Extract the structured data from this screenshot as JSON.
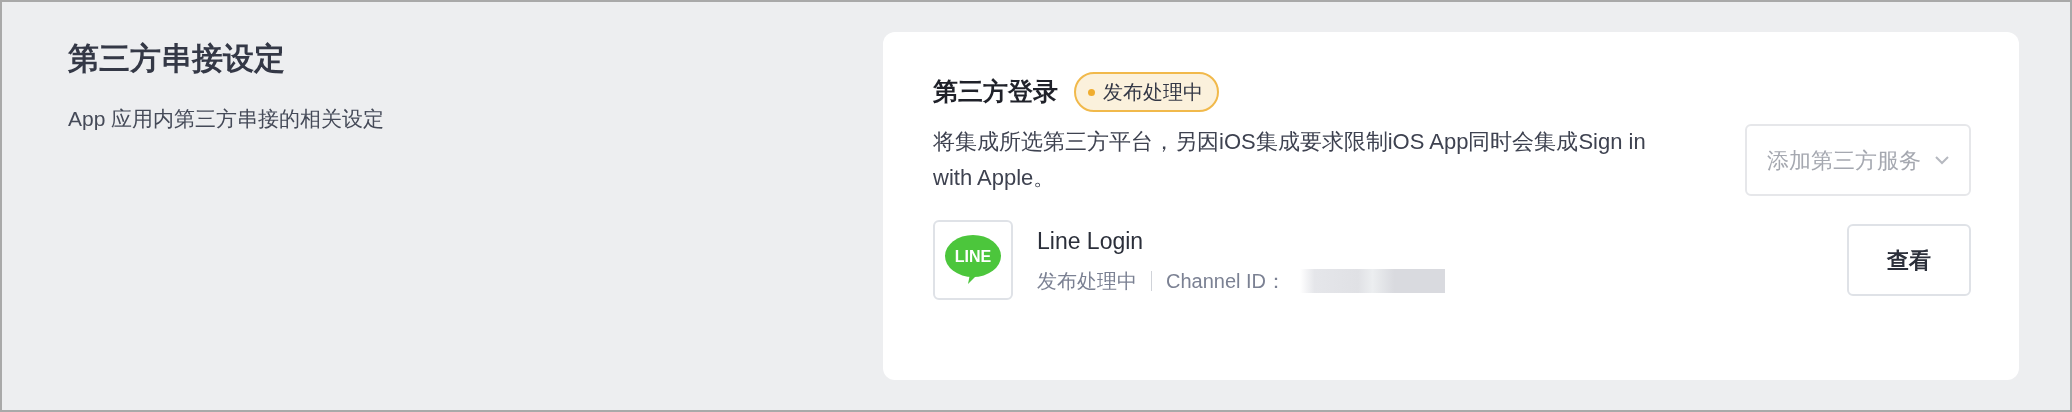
{
  "section": {
    "title": "第三方串接设定",
    "subtitle": "App 应用内第三方串接的相关设定"
  },
  "card": {
    "title": "第三方登录",
    "status_badge": "发布处理中",
    "description": "将集成所选第三方平台，另因iOS集成要求限制iOS App同时会集成Sign in with Apple。",
    "add_button": {
      "label": "添加第三方服务",
      "disabled": true
    },
    "services": [
      {
        "logo_text": "LINE",
        "name": "Line Login",
        "status": "发布处理中",
        "channel_label": "Channel ID：",
        "channel_redacted": true,
        "button": "查看"
      }
    ]
  }
}
